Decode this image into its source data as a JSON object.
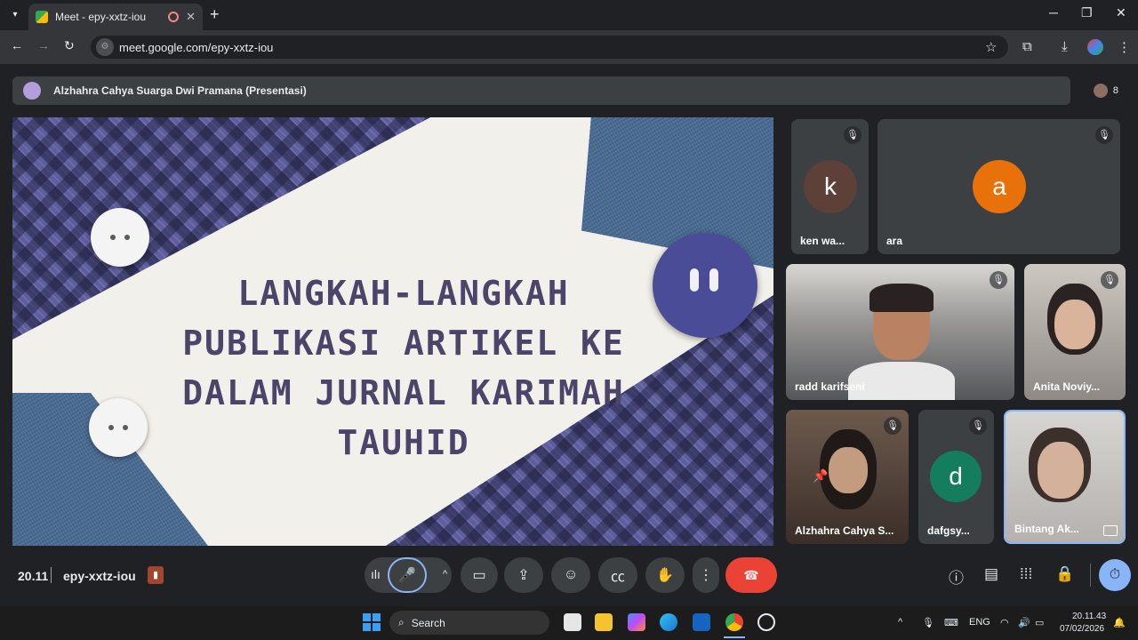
{
  "browser": {
    "tab_title": "Meet - epy-xxtz-iou",
    "new_tab": "+",
    "url": "meet.google.com/epy-xxtz-iou",
    "win_min": "─",
    "win_max": "❐",
    "win_close": "✕"
  },
  "meet": {
    "presenter_label": "Alzhahra Cahya Suarga Dwi Pramana (Presentasi)",
    "participant_count": "8",
    "slide_title": "LANGKAH-LANGKAH PUBLIKASI ARTIKEL KE DALAM JURNAL KARIMAH TAUHID",
    "tiles": [
      {
        "name": "ken wa...",
        "initial": "k",
        "avatar_color": "#5d4037"
      },
      {
        "name": "ara",
        "initial": "a",
        "avatar_color": "#e8710a"
      },
      {
        "name": "radd karifseni"
      },
      {
        "name": "Anita Noviy..."
      },
      {
        "name": "Alzhahra Cahya S..."
      },
      {
        "name": "dafgsy...",
        "initial": "d",
        "avatar_color": "#137d5e"
      },
      {
        "name": "Bintang Ak..."
      }
    ],
    "time": "20.11",
    "meeting_code": "epy-xxtz-iou"
  },
  "taskbar": {
    "search_placeholder": "Search",
    "lang": "ENG",
    "clock_time": "20.11.43",
    "clock_date": "07/02/2026"
  },
  "colors": {
    "accent_blue": "#8ab4f8",
    "end_call_red": "#ea4335",
    "slide_text": "#4a4569"
  },
  "icons": [
    "tab-menu-icon",
    "recording-icon",
    "back-icon",
    "forward-icon",
    "reload-icon",
    "bookmark-star-icon",
    "extensions-icon",
    "download-icon",
    "more-icon",
    "mic-icon",
    "camera-icon",
    "present-icon",
    "emoji-icon",
    "captions-icon",
    "raise-hand-icon",
    "end-call-icon",
    "info-icon",
    "chat-icon",
    "activities-icon",
    "host-controls-icon",
    "timer-icon",
    "windows-start-icon"
  ]
}
